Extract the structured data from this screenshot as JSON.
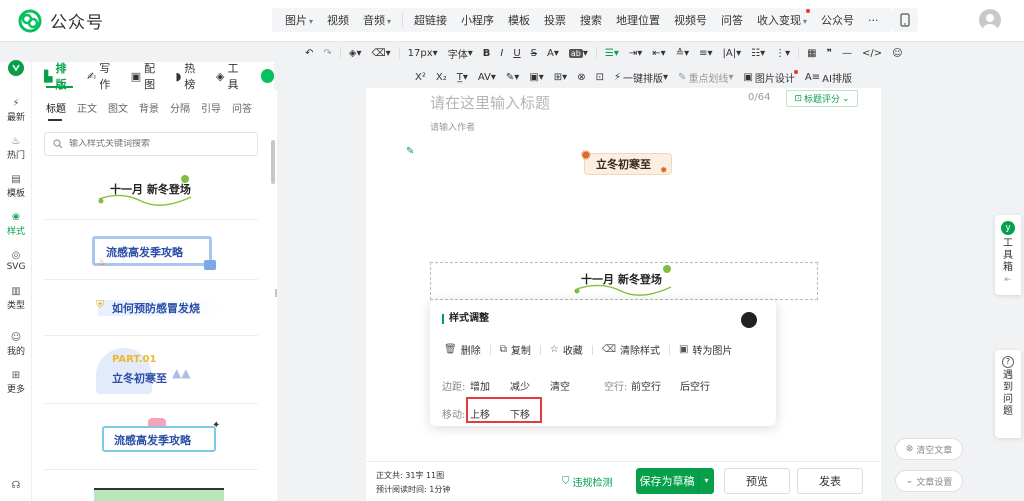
{
  "app": {
    "title": "公众号"
  },
  "topmenu": {
    "items": [
      {
        "label": "图片",
        "dropdown": true
      },
      {
        "label": "视频",
        "dropdown": false
      },
      {
        "label": "音频",
        "dropdown": true
      },
      {
        "label": "超链接",
        "dropdown": false
      },
      {
        "label": "小程序",
        "dropdown": false
      },
      {
        "label": "模板",
        "dropdown": false
      },
      {
        "label": "投票",
        "dropdown": false
      },
      {
        "label": "搜索",
        "dropdown": false
      },
      {
        "label": "地理位置",
        "dropdown": false
      },
      {
        "label": "视频号",
        "dropdown": false
      },
      {
        "label": "问答",
        "dropdown": false
      },
      {
        "label": "收入变现",
        "dropdown": true
      },
      {
        "label": "公众号",
        "dropdown": false
      },
      {
        "label": "···",
        "dropdown": false
      }
    ]
  },
  "nav": {
    "tabs": [
      "排版",
      "写作",
      "配图",
      "热榜",
      "工具"
    ],
    "side": [
      "最新",
      "热门",
      "模板",
      "样式",
      "SVG",
      "类型",
      "我的",
      "更多"
    ]
  },
  "stylepanel": {
    "subtabs": [
      "标题",
      "正文",
      "图文",
      "背景",
      "分隔",
      "引导",
      "问答"
    ],
    "search_placeholder": "输入样式关键词搜索",
    "cards": [
      "十一月 新冬登场",
      "流感高发季攻略",
      "如何预防感冒发烧",
      "PART.01",
      "立冬初寒至",
      "流感高发季攻略"
    ]
  },
  "toolbar1": {
    "fontsize": "17px",
    "font": "字体"
  },
  "toolbar2": {
    "onekey": "一键排版",
    "highlight": "重点划线",
    "imgdesign": "图片设计",
    "ai": "AI排版"
  },
  "editor": {
    "title_placeholder": "请在这里输入标题",
    "title_count": "0/64",
    "title_score": "标题评分",
    "author_placeholder": "请输入作者",
    "banner1": "立冬初寒至",
    "banner2": "十一月 新冬登场"
  },
  "popup": {
    "title": "样式调整",
    "actions": [
      "删除",
      "复制",
      "收藏",
      "清除样式",
      "转为图片"
    ],
    "margin_label": "边距:",
    "margin_options": [
      "增加",
      "减少",
      "清空"
    ],
    "line_label": "空行:",
    "line_options": [
      "前空行",
      "后空行"
    ],
    "move_label": "移动:",
    "move_options": [
      "上移",
      "下移"
    ]
  },
  "bottombar": {
    "stat1": "正文共: 31字 11图",
    "stat2": "预计阅读时间: 1分钟",
    "violation": "违规检测",
    "save": "保存为草稿",
    "preview": "预览",
    "publish": "发表"
  },
  "right": {
    "toolbox": [
      "工",
      "具",
      "箱"
    ],
    "help": [
      "遇",
      "到",
      "问",
      "题"
    ],
    "clear": "清空文章",
    "settings": "文章设置"
  }
}
